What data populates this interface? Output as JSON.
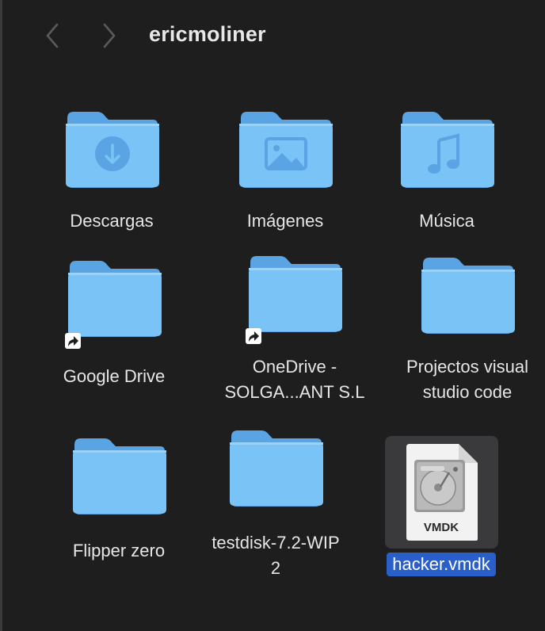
{
  "toolbar": {
    "title": "ericmoliner",
    "back_icon": "chevron-left-icon",
    "forward_icon": "chevron-right-icon"
  },
  "colors": {
    "background": "#1e1e1e",
    "folder_front": "#79c3f6",
    "folder_back": "#5aa4e3",
    "selection": "#2a5ec8"
  },
  "items": [
    {
      "label": "Descargas",
      "icon": "downloads-folder-icon"
    },
    {
      "label": "Imágenes",
      "icon": "pictures-folder-icon"
    },
    {
      "label": "Música",
      "icon": "music-folder-icon"
    },
    {
      "label": "Google Drive",
      "icon": "folder-alias-icon"
    },
    {
      "label_line1": "OneDrive -",
      "label_line2": "SOLGA...ANT S.L",
      "icon": "folder-alias-icon"
    },
    {
      "label_line1": "Projectos visual",
      "label_line2": "studio code",
      "icon": "folder-icon"
    },
    {
      "label": "Flipper zero",
      "icon": "folder-icon"
    },
    {
      "label_line1": "testdisk-7.2-WIP",
      "label_line2": "2",
      "icon": "folder-icon"
    },
    {
      "label": "hacker.vmdk",
      "icon": "vmdk-file-icon",
      "badge": "VMDK",
      "selected": true
    }
  ]
}
